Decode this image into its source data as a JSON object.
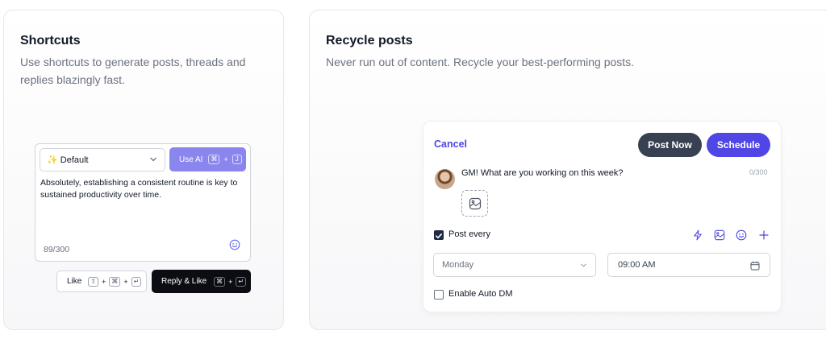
{
  "shortcuts": {
    "title": "Shortcuts",
    "description": "Use shortcuts to generate posts, threads and replies blazingly fast.",
    "preset_select": {
      "value": "✨ Default"
    },
    "use_ai": {
      "label": "Use AI",
      "keys": [
        "⌘",
        "+",
        "J"
      ]
    },
    "reply_text": "Absolutely, establishing a consistent routine is key to sustained productivity over time.",
    "char_count": "89/300",
    "like_button": {
      "label": "Like",
      "keys": [
        "⇧",
        "+",
        "⌘",
        "+",
        "↵"
      ]
    },
    "reply_like_button": {
      "label": "Reply & Like",
      "keys": [
        "⌘",
        "+",
        "↵"
      ]
    },
    "icons": {
      "emoji": "smiley-icon",
      "chevron": "chevron-down-icon"
    }
  },
  "recycle": {
    "title": "Recycle posts",
    "description": "Never run out of content. Recycle your best-performing posts.",
    "cancel_label": "Cancel",
    "post_now_label": "Post Now",
    "schedule_label": "Schedule",
    "post_text": "GM! What are you working on this week?",
    "char_count": "0/300",
    "post_every": {
      "label": "Post every",
      "checked": true
    },
    "day_select": {
      "value": "Monday"
    },
    "time_input": {
      "value": "09:00 AM"
    },
    "auto_dm": {
      "label": "Enable Auto DM",
      "checked": false
    },
    "toolbar_icons": [
      "lightning-icon",
      "image-icon",
      "smiley-icon",
      "plus-icon"
    ]
  },
  "colors": {
    "accent": "#4f46e5",
    "use_ai_bg": "#8b86ee",
    "post_now_bg": "#374151",
    "reply_like_bg": "#0b0d12"
  }
}
